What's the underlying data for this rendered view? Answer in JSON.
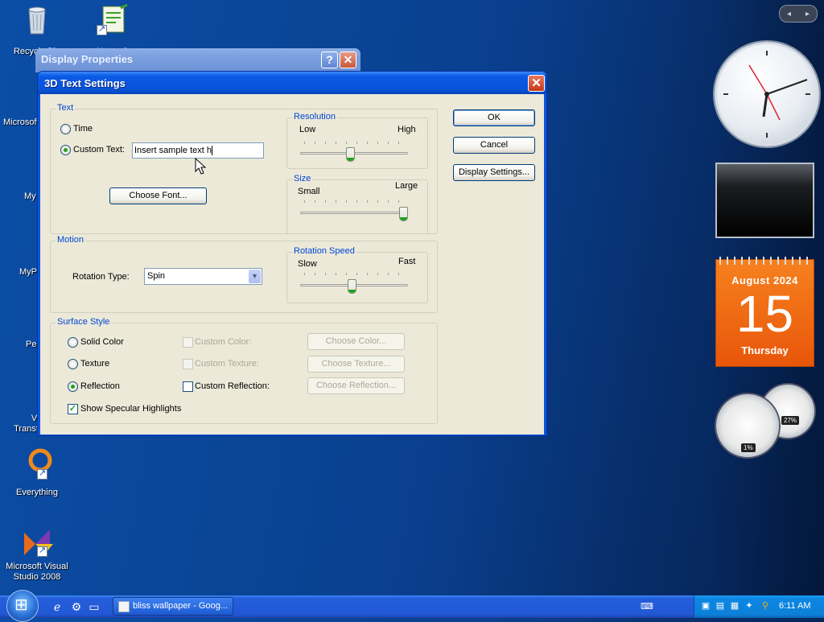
{
  "desktop": {
    "icons": [
      {
        "label": "Recycle Bin",
        "icon": "recycle-bin-icon"
      },
      {
        "label": "Network",
        "icon": "network-icon"
      },
      {
        "label": "Microsoft",
        "icon": "office-icon"
      },
      {
        "label": "My",
        "icon": "shortcut-icon"
      },
      {
        "label": "MyP",
        "icon": "shortcut-icon"
      },
      {
        "label": "Pe",
        "icon": "shortcut-icon"
      },
      {
        "label": "Vis Transfo",
        "icon": "shortcut-icon"
      },
      {
        "label": "Everything",
        "icon": "everything-icon"
      },
      {
        "label": "Microsoft Visual Studio 2008",
        "icon": "visual-studio-icon"
      }
    ]
  },
  "back_window": {
    "title": "Display Properties",
    "help_glyph": "?",
    "close_glyph": "✕"
  },
  "dialog": {
    "title": "3D Text Settings",
    "close_glyph": "✕",
    "text_group": {
      "legend": "Text",
      "time_label": "Time",
      "custom_text_label": "Custom Text:",
      "custom_text_value": "Insert sample text h",
      "selected": "custom",
      "choose_font": "Choose Font..."
    },
    "resolution": {
      "legend": "Resolution",
      "low": "Low",
      "high": "High",
      "value_fraction": 0.46
    },
    "size": {
      "legend": "Size",
      "small": "Small",
      "large": "Large",
      "value_fraction": 1.0
    },
    "motion_group": {
      "legend": "Motion",
      "rotation_type_label": "Rotation Type:",
      "rotation_type_value": "Spin"
    },
    "rotation_speed": {
      "legend": "Rotation Speed",
      "slow": "Slow",
      "fast": "Fast",
      "value_fraction": 0.48
    },
    "surface_group": {
      "legend": "Surface Style",
      "solid_color": "Solid Color",
      "texture": "Texture",
      "reflection": "Reflection",
      "selected": "reflection",
      "custom_color": "Custom Color:",
      "custom_texture": "Custom Texture:",
      "custom_reflection": "Custom Reflection:",
      "choose_color": "Choose Color...",
      "choose_texture": "Choose Texture...",
      "choose_reflection": "Choose Reflection...",
      "show_specular": "Show Specular Highlights",
      "show_specular_checked": true
    },
    "buttons": {
      "ok": "OK",
      "cancel": "Cancel",
      "display_settings": "Display Settings..."
    }
  },
  "sidebar": {
    "nav_prev": "◂",
    "nav_next": "▸",
    "calendar": {
      "month": "August 2024",
      "day": "15",
      "weekday": "Thursday"
    },
    "cpu_gauge": "1%",
    "mem_gauge": "27%"
  },
  "taskbar": {
    "task_button": "bliss wallpaper - Goog...",
    "time": "6:11 AM"
  },
  "colors": {
    "accent_blue": "#0a55e0",
    "calendar_orange": "#f26d16",
    "group_legend": "#0046d5",
    "radio_check_green": "#21a121"
  }
}
